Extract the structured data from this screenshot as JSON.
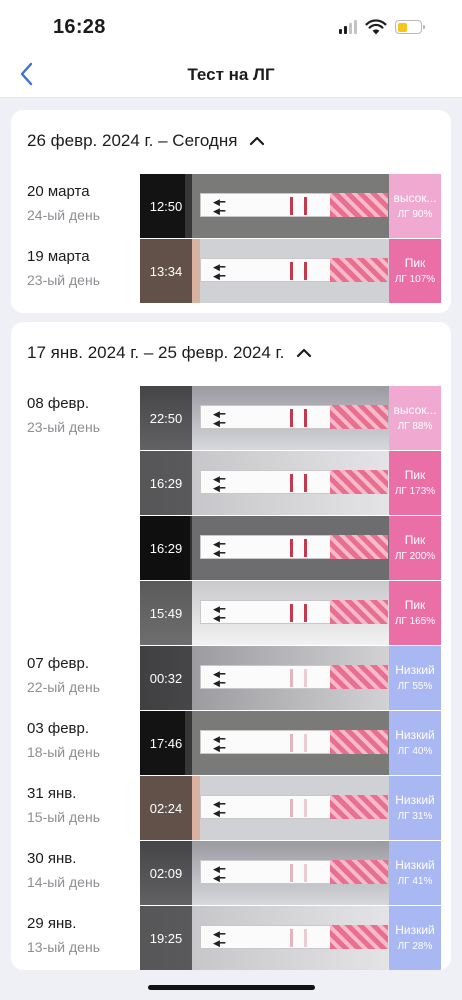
{
  "status": {
    "time": "16:28"
  },
  "nav": {
    "title": "Тест на ЛГ",
    "back_icon": "chevron-left-icon"
  },
  "colors": {
    "high": "#f0a9d0",
    "peak": "#ea6fa7",
    "low": "#a9b8f3",
    "accent": "#3b6fd6"
  },
  "sections": [
    {
      "title": "26 февр. 2024 г. – Сегодня",
      "expanded": true,
      "days": [
        {
          "date": "20 марта",
          "cycle": "24-ый день",
          "tests": [
            {
              "time": "12:50",
              "level": "высок...",
              "lh": "ЛГ 90%",
              "kind": "high"
            }
          ]
        },
        {
          "date": "19 марта",
          "cycle": "23-ый день",
          "tests": [
            {
              "time": "13:34",
              "level": "Пик",
              "lh": "ЛГ 107%",
              "kind": "peak"
            }
          ]
        }
      ]
    },
    {
      "title": "17 янв. 2024 г. – 25 февр. 2024 г.",
      "expanded": true,
      "days": [
        {
          "date": "08 февр.",
          "cycle": "23-ый день",
          "tests": [
            {
              "time": "22:50",
              "level": "высок...",
              "lh": "ЛГ 88%",
              "kind": "high"
            },
            {
              "time": "16:29",
              "level": "Пик",
              "lh": "ЛГ 173%",
              "kind": "peak"
            },
            {
              "time": "16:29",
              "level": "Пик",
              "lh": "ЛГ 200%",
              "kind": "peak"
            },
            {
              "time": "15:49",
              "level": "Пик",
              "lh": "ЛГ 165%",
              "kind": "peak"
            }
          ]
        },
        {
          "date": "07 февр.",
          "cycle": "22-ый день",
          "tests": [
            {
              "time": "00:32",
              "level": "Низкий",
              "lh": "ЛГ 55%",
              "kind": "low"
            }
          ]
        },
        {
          "date": "03 февр.",
          "cycle": "18-ый день",
          "tests": [
            {
              "time": "17:46",
              "level": "Низкий",
              "lh": "ЛГ 40%",
              "kind": "low"
            }
          ]
        },
        {
          "date": "31 янв.",
          "cycle": "15-ый день",
          "tests": [
            {
              "time": "02:24",
              "level": "Низкий",
              "lh": "ЛГ 31%",
              "kind": "low"
            }
          ]
        },
        {
          "date": "30 янв.",
          "cycle": "14-ый день",
          "tests": [
            {
              "time": "02:09",
              "level": "Низкий",
              "lh": "ЛГ 41%",
              "kind": "low"
            }
          ]
        },
        {
          "date": "29 янв.",
          "cycle": "13-ый день",
          "tests": [
            {
              "time": "19:25",
              "level": "Низкий",
              "lh": "ЛГ 28%",
              "kind": "low"
            }
          ]
        }
      ]
    }
  ]
}
